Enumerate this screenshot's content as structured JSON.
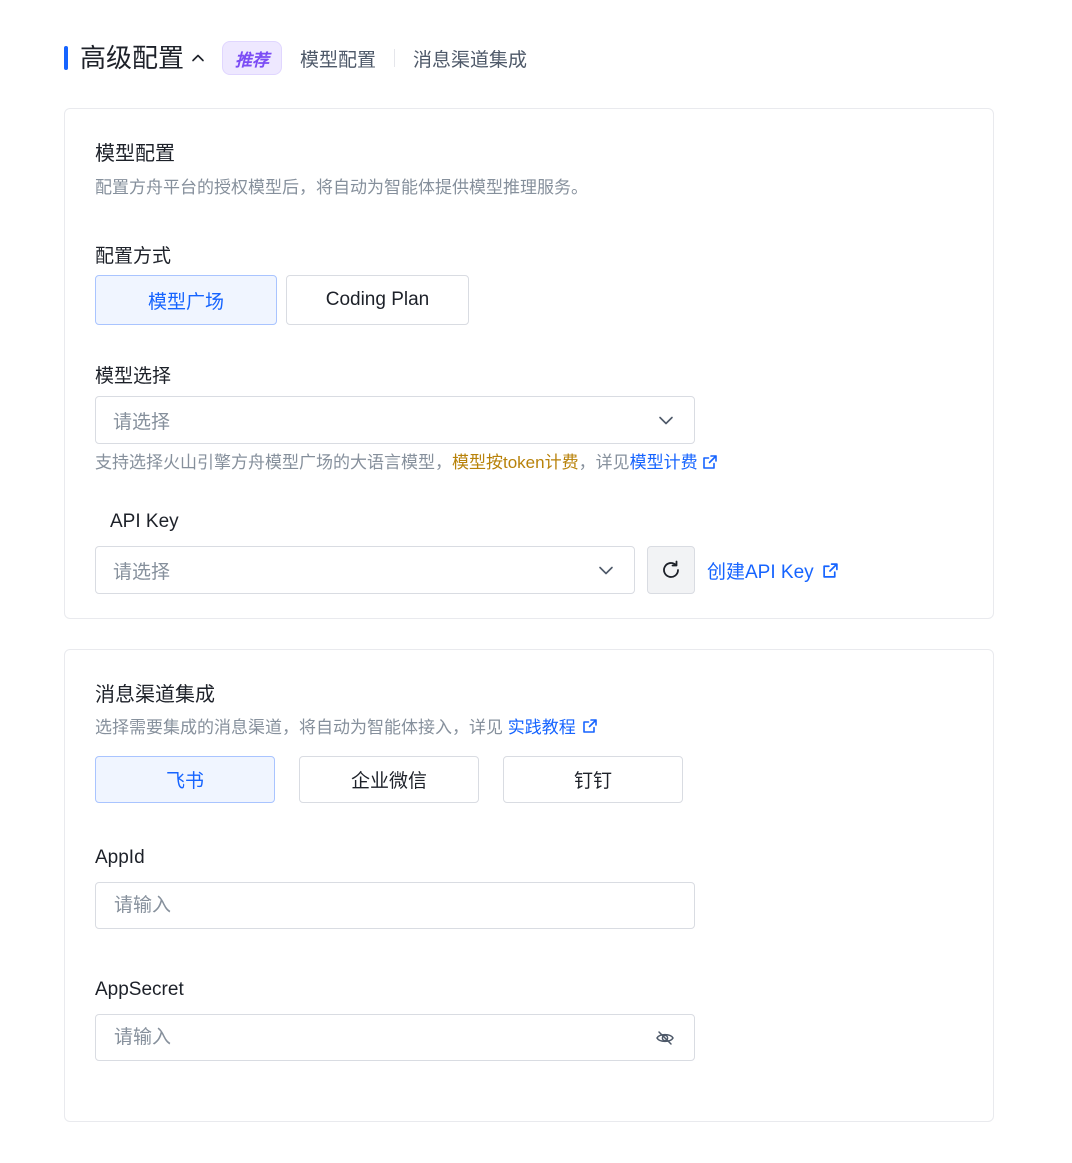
{
  "header": {
    "title": "高级配置",
    "badge": "推荐",
    "links": [
      "模型配置",
      "消息渠道集成"
    ]
  },
  "model_config": {
    "title": "模型配置",
    "description": "配置方舟平台的授权模型后，将自动为智能体提供模型推理服务。",
    "method_label": "配置方式",
    "method_options": [
      "模型广场",
      "Coding Plan"
    ],
    "method_selected": "模型广场",
    "model_select_label": "模型选择",
    "model_select_placeholder": "请选择",
    "model_hint_prefix": "支持选择火山引擎方舟模型广场的大语言模型，",
    "model_hint_highlight": "模型按token计费",
    "model_hint_mid": "，详见",
    "model_hint_link": "模型计费",
    "api_key_label": "API Key",
    "api_key_placeholder": "请选择",
    "create_api_key_link": "创建API Key"
  },
  "channel": {
    "title": "消息渠道集成",
    "description_prefix": "选择需要集成的消息渠道，将自动为智能体接入，详见",
    "description_link": "实践教程",
    "options": [
      "飞书",
      "企业微信",
      "钉钉"
    ],
    "selected": "飞书",
    "appid_label": "AppId",
    "appid_placeholder": "请输入",
    "appsecret_label": "AppSecret",
    "appsecret_placeholder": "请输入"
  },
  "colors": {
    "accent": "#1664ff",
    "badge_text": "#7b4cf5",
    "badge_bg": "#eee8ff",
    "highlight": "#b8820a"
  },
  "icons": [
    "chevron-up-icon",
    "chevron-down-icon",
    "external-link-icon",
    "refresh-icon",
    "eye-off-icon"
  ]
}
